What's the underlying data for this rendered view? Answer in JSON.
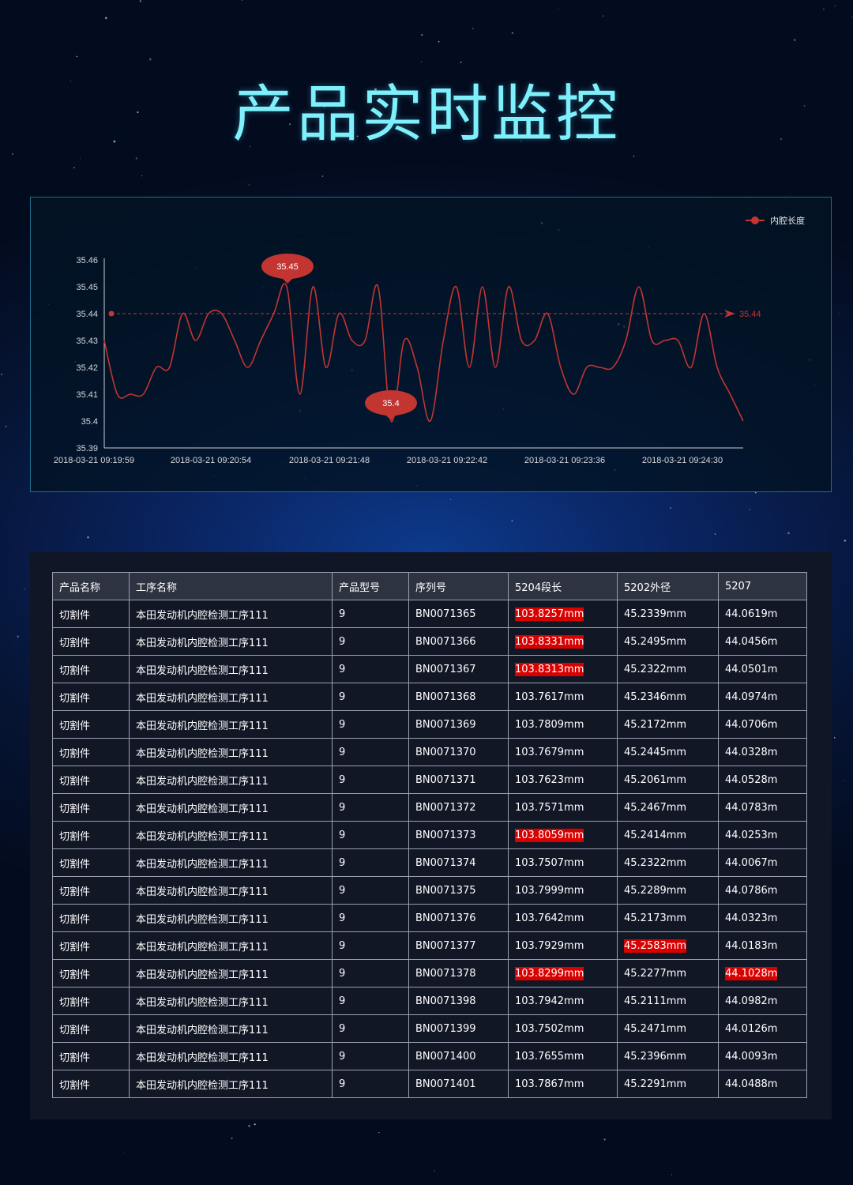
{
  "page": {
    "title": "产品实时监控"
  },
  "chart_data": {
    "type": "line",
    "legend": {
      "name": "内腔长度",
      "position": "top-right",
      "color": "#c23531"
    },
    "y_ticks": [
      "35.46",
      "35.45",
      "35.44",
      "35.43",
      "35.42",
      "35.41",
      "35.4",
      "35.39"
    ],
    "ylim": [
      35.39,
      35.46
    ],
    "x_ticks": [
      "2018-03-21 09:19:59",
      "2018-03-21 09:20:54",
      "2018-03-21 09:21:48",
      "2018-03-21 09:22:42",
      "2018-03-21 09:23:36",
      "2018-03-21 09:24:30"
    ],
    "series": [
      {
        "name": "内腔长度",
        "values": [
          35.43,
          35.41,
          35.41,
          35.41,
          35.42,
          35.42,
          35.44,
          35.43,
          35.44,
          35.44,
          35.43,
          35.42,
          35.43,
          35.44,
          35.45,
          35.41,
          35.45,
          35.42,
          35.44,
          35.43,
          35.43,
          35.45,
          35.4,
          35.43,
          35.42,
          35.4,
          35.43,
          35.45,
          35.42,
          35.45,
          35.42,
          35.45,
          35.43,
          35.43,
          35.44,
          35.42,
          35.41,
          35.42,
          35.42,
          35.42,
          35.43,
          35.45,
          35.43,
          35.43,
          35.43,
          35.42,
          35.44,
          35.42,
          35.41,
          35.4
        ]
      }
    ],
    "max_point": {
      "label": "35.45"
    },
    "min_point": {
      "label": "35.4"
    },
    "average_line": {
      "label": "35.44",
      "value": 35.44
    }
  },
  "table": {
    "headers": [
      "产品名称",
      "工序名称",
      "产品型号",
      "序列号",
      "5204段长",
      "5202外径",
      "5207"
    ],
    "rows": [
      {
        "name": "切割件",
        "process": "本田发动机内腔检测工序111",
        "model": "9",
        "serial": "BN0071365",
        "seg": "103.8257mm",
        "seg_alert": true,
        "od": "45.2339mm",
        "od_alert": false,
        "v5207": "44.0619m",
        "v5207_alert": false
      },
      {
        "name": "切割件",
        "process": "本田发动机内腔检测工序111",
        "model": "9",
        "serial": "BN0071366",
        "seg": "103.8331mm",
        "seg_alert": true,
        "od": "45.2495mm",
        "od_alert": false,
        "v5207": "44.0456m",
        "v5207_alert": false
      },
      {
        "name": "切割件",
        "process": "本田发动机内腔检测工序111",
        "model": "9",
        "serial": "BN0071367",
        "seg": "103.8313mm",
        "seg_alert": true,
        "od": "45.2322mm",
        "od_alert": false,
        "v5207": "44.0501m",
        "v5207_alert": false
      },
      {
        "name": "切割件",
        "process": "本田发动机内腔检测工序111",
        "model": "9",
        "serial": "BN0071368",
        "seg": "103.7617mm",
        "seg_alert": false,
        "od": "45.2346mm",
        "od_alert": false,
        "v5207": "44.0974m",
        "v5207_alert": false
      },
      {
        "name": "切割件",
        "process": "本田发动机内腔检测工序111",
        "model": "9",
        "serial": "BN0071369",
        "seg": "103.7809mm",
        "seg_alert": false,
        "od": "45.2172mm",
        "od_alert": false,
        "v5207": "44.0706m",
        "v5207_alert": false
      },
      {
        "name": "切割件",
        "process": "本田发动机内腔检测工序111",
        "model": "9",
        "serial": "BN0071370",
        "seg": "103.7679mm",
        "seg_alert": false,
        "od": "45.2445mm",
        "od_alert": false,
        "v5207": "44.0328m",
        "v5207_alert": false
      },
      {
        "name": "切割件",
        "process": "本田发动机内腔检测工序111",
        "model": "9",
        "serial": "BN0071371",
        "seg": "103.7623mm",
        "seg_alert": false,
        "od": "45.2061mm",
        "od_alert": false,
        "v5207": "44.0528m",
        "v5207_alert": false
      },
      {
        "name": "切割件",
        "process": "本田发动机内腔检测工序111",
        "model": "9",
        "serial": "BN0071372",
        "seg": "103.7571mm",
        "seg_alert": false,
        "od": "45.2467mm",
        "od_alert": false,
        "v5207": "44.0783m",
        "v5207_alert": false
      },
      {
        "name": "切割件",
        "process": "本田发动机内腔检测工序111",
        "model": "9",
        "serial": "BN0071373",
        "seg": "103.8059mm",
        "seg_alert": true,
        "od": "45.2414mm",
        "od_alert": false,
        "v5207": "44.0253m",
        "v5207_alert": false
      },
      {
        "name": "切割件",
        "process": "本田发动机内腔检测工序111",
        "model": "9",
        "serial": "BN0071374",
        "seg": "103.7507mm",
        "seg_alert": false,
        "od": "45.2322mm",
        "od_alert": false,
        "v5207": "44.0067m",
        "v5207_alert": false
      },
      {
        "name": "切割件",
        "process": "本田发动机内腔检测工序111",
        "model": "9",
        "serial": "BN0071375",
        "seg": "103.7999mm",
        "seg_alert": false,
        "od": "45.2289mm",
        "od_alert": false,
        "v5207": "44.0786m",
        "v5207_alert": false
      },
      {
        "name": "切割件",
        "process": "本田发动机内腔检测工序111",
        "model": "9",
        "serial": "BN0071376",
        "seg": "103.7642mm",
        "seg_alert": false,
        "od": "45.2173mm",
        "od_alert": false,
        "v5207": "44.0323m",
        "v5207_alert": false
      },
      {
        "name": "切割件",
        "process": "本田发动机内腔检测工序111",
        "model": "9",
        "serial": "BN0071377",
        "seg": "103.7929mm",
        "seg_alert": false,
        "od": "45.2583mm",
        "od_alert": true,
        "v5207": "44.0183m",
        "v5207_alert": false
      },
      {
        "name": "切割件",
        "process": "本田发动机内腔检测工序111",
        "model": "9",
        "serial": "BN0071378",
        "seg": "103.8299mm",
        "seg_alert": true,
        "od": "45.2277mm",
        "od_alert": false,
        "v5207": "44.1028m",
        "v5207_alert": true
      },
      {
        "name": "切割件",
        "process": "本田发动机内腔检测工序111",
        "model": "9",
        "serial": "BN0071398",
        "seg": "103.7942mm",
        "seg_alert": false,
        "od": "45.2111mm",
        "od_alert": false,
        "v5207": "44.0982m",
        "v5207_alert": false
      },
      {
        "name": "切割件",
        "process": "本田发动机内腔检测工序111",
        "model": "9",
        "serial": "BN0071399",
        "seg": "103.7502mm",
        "seg_alert": false,
        "od": "45.2471mm",
        "od_alert": false,
        "v5207": "44.0126m",
        "v5207_alert": false
      },
      {
        "name": "切割件",
        "process": "本田发动机内腔检测工序111",
        "model": "9",
        "serial": "BN0071400",
        "seg": "103.7655mm",
        "seg_alert": false,
        "od": "45.2396mm",
        "od_alert": false,
        "v5207": "44.0093m",
        "v5207_alert": false
      },
      {
        "name": "切割件",
        "process": "本田发动机内腔检测工序111",
        "model": "9",
        "serial": "BN0071401",
        "seg": "103.7867mm",
        "seg_alert": false,
        "od": "45.2291mm",
        "od_alert": false,
        "v5207": "44.0488m",
        "v5207_alert": false
      }
    ]
  },
  "colors": {
    "title": "#7df0fb",
    "line": "#c23531",
    "alert_bg": "#d90000",
    "panel_border": "#1d6d8a"
  }
}
